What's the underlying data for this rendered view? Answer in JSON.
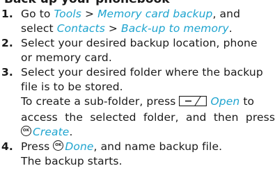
{
  "heading": "Back up your phonebook",
  "steps": [
    {
      "number": "1.",
      "part1": "Go to ",
      "tools": "Tools",
      "sep1": " > ",
      "memory_card_backup": "Memory card backup",
      "part2": ", and",
      "part3": "select ",
      "contacts": "Contacts",
      "sep2": " > ",
      "backup_to_memory": "Back-up to memory",
      "part4": "."
    },
    {
      "number": "2.",
      "line1": "Select your desired backup location, phone",
      "line2": "or memory card."
    },
    {
      "number": "3.",
      "line1": "Select your desired folder where the backup",
      "line2": "file is to be stored.",
      "subfolder_part1": "To create a sub-folder, press ",
      "open": "Open",
      "subfolder_part2": " to",
      "subfolder_line2": "access the selected folder, and then press",
      "create": "Create",
      "create_end": "."
    },
    {
      "number": "4.",
      "part1": "Press ",
      "done": "Done",
      "part2": ", and name backup file.",
      "line2": "The backup starts."
    }
  ],
  "ok_key_label": "OK",
  "icons": {
    "softkey": "left-softkey-icon",
    "ok": "ok-key-icon"
  },
  "colors": {
    "ui_term": "#1ea4cf",
    "text": "#1a1a1a"
  }
}
